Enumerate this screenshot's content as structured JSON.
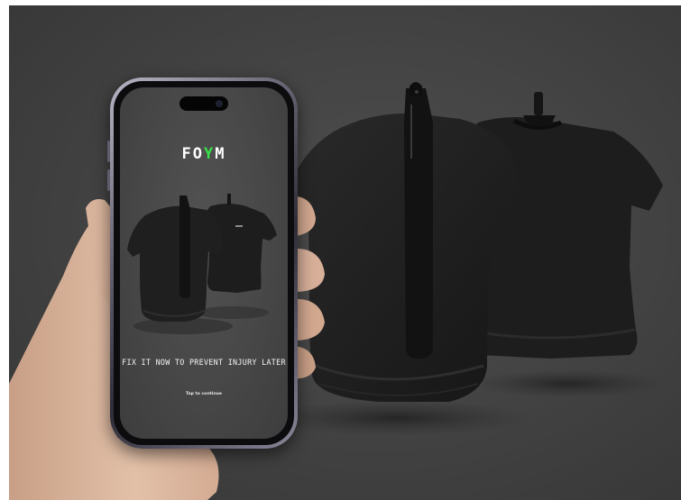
{
  "app": {
    "logo_prefix": "FO",
    "logo_accent": "Y",
    "logo_suffix": "M",
    "accent_color": "#37e24a",
    "tagline": "FIX IT NOW TO PREVENT INJURY LATER",
    "tap_prompt": "Tap to continue"
  },
  "scene": {
    "background_color": "#444444",
    "shirt_color": "#1f1f1f",
    "icons": [
      "posture-shirt-back",
      "tshirt-front",
      "smartphone",
      "hand"
    ]
  }
}
